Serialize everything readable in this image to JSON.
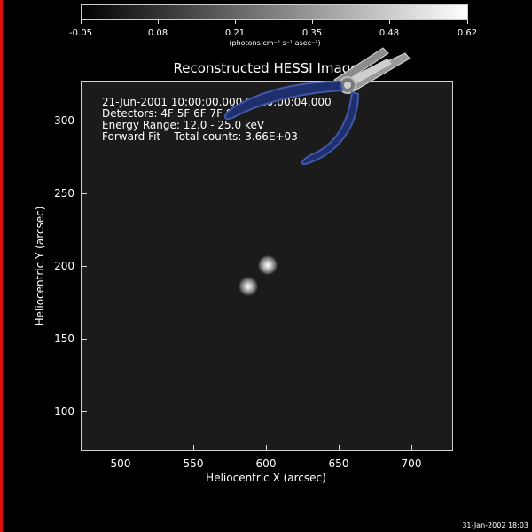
{
  "colorbar": {
    "labels": [
      "-0.05",
      "0.08",
      "0.21",
      "0.35",
      "0.48",
      "0.62"
    ],
    "units": "(photons cm⁻² s⁻¹ asec⁻²)"
  },
  "plot": {
    "title": "Reconstructed HESSI Image",
    "info_lines": [
      "21-Jun-2001 10:00:00.000 to 10:00:04.000",
      "Detectors: 4F 5F 6F 7F 8F",
      "Energy Range: 12.0 - 25.0 keV",
      "Forward Fit    Total counts: 3.66E+03"
    ],
    "x_ticks": [
      "500",
      "550",
      "600",
      "650",
      "700"
    ],
    "y_ticks": [
      "100",
      "150",
      "200",
      "250",
      "300"
    ],
    "xlabel": "Heliocentric X (arcsec)",
    "ylabel": "Heliocentric Y (arcsec)"
  },
  "timestamp": "31-Jan-2002 18:03",
  "overlay": {
    "icon": "pliers-icon"
  }
}
